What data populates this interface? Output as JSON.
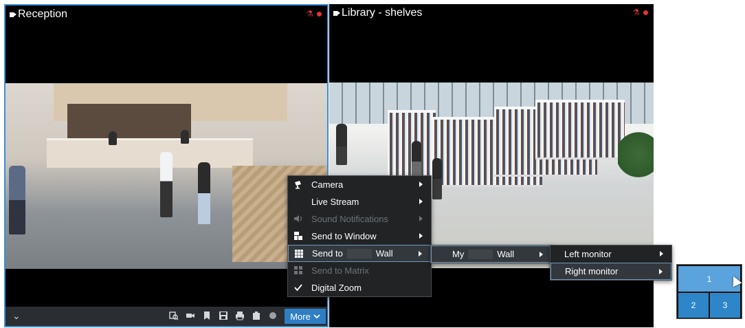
{
  "panes": {
    "left": {
      "title": "Reception"
    },
    "right": {
      "title": "Library - shelves"
    }
  },
  "toolbar": {
    "more_label": "More",
    "icons": [
      "search-video-icon",
      "camera-icon",
      "bookmark-icon",
      "save-icon",
      "print-icon",
      "clipboard-icon",
      "record-icon"
    ]
  },
  "context_menu": {
    "items": [
      {
        "label": "Camera",
        "icon": "camera-icon",
        "submenu": true,
        "enabled": true
      },
      {
        "label": "Live Stream",
        "icon": "",
        "submenu": true,
        "enabled": true
      },
      {
        "label": "Sound Notifications",
        "icon": "speaker-icon",
        "submenu": true,
        "enabled": false
      },
      {
        "label": "Send to Window",
        "icon": "window-icon",
        "submenu": true,
        "enabled": true
      },
      {
        "label_prefix": "Send to",
        "label_suffix": "Wall",
        "icon": "grid-icon",
        "submenu": true,
        "enabled": true,
        "highlighted": true
      },
      {
        "label": "Send to Matrix",
        "icon": "matrix-icon",
        "submenu": false,
        "enabled": false
      },
      {
        "label": "Digital Zoom",
        "icon": "check-icon",
        "submenu": false,
        "enabled": true,
        "checked": true
      }
    ]
  },
  "wall_menu": {
    "item_prefix": "My",
    "item_suffix": "Wall"
  },
  "monitor_menu": {
    "items": [
      {
        "label": "Left monitor"
      },
      {
        "label": "Right monitor",
        "highlighted": true
      }
    ]
  },
  "monitor_grid": {
    "tiles": [
      "1",
      "2",
      "3"
    ],
    "selected": "1"
  },
  "colors": {
    "accent": "#2f7ec4",
    "selection_border": "#3b8fd6",
    "menu_bg": "#212325",
    "record": "#e53333"
  }
}
